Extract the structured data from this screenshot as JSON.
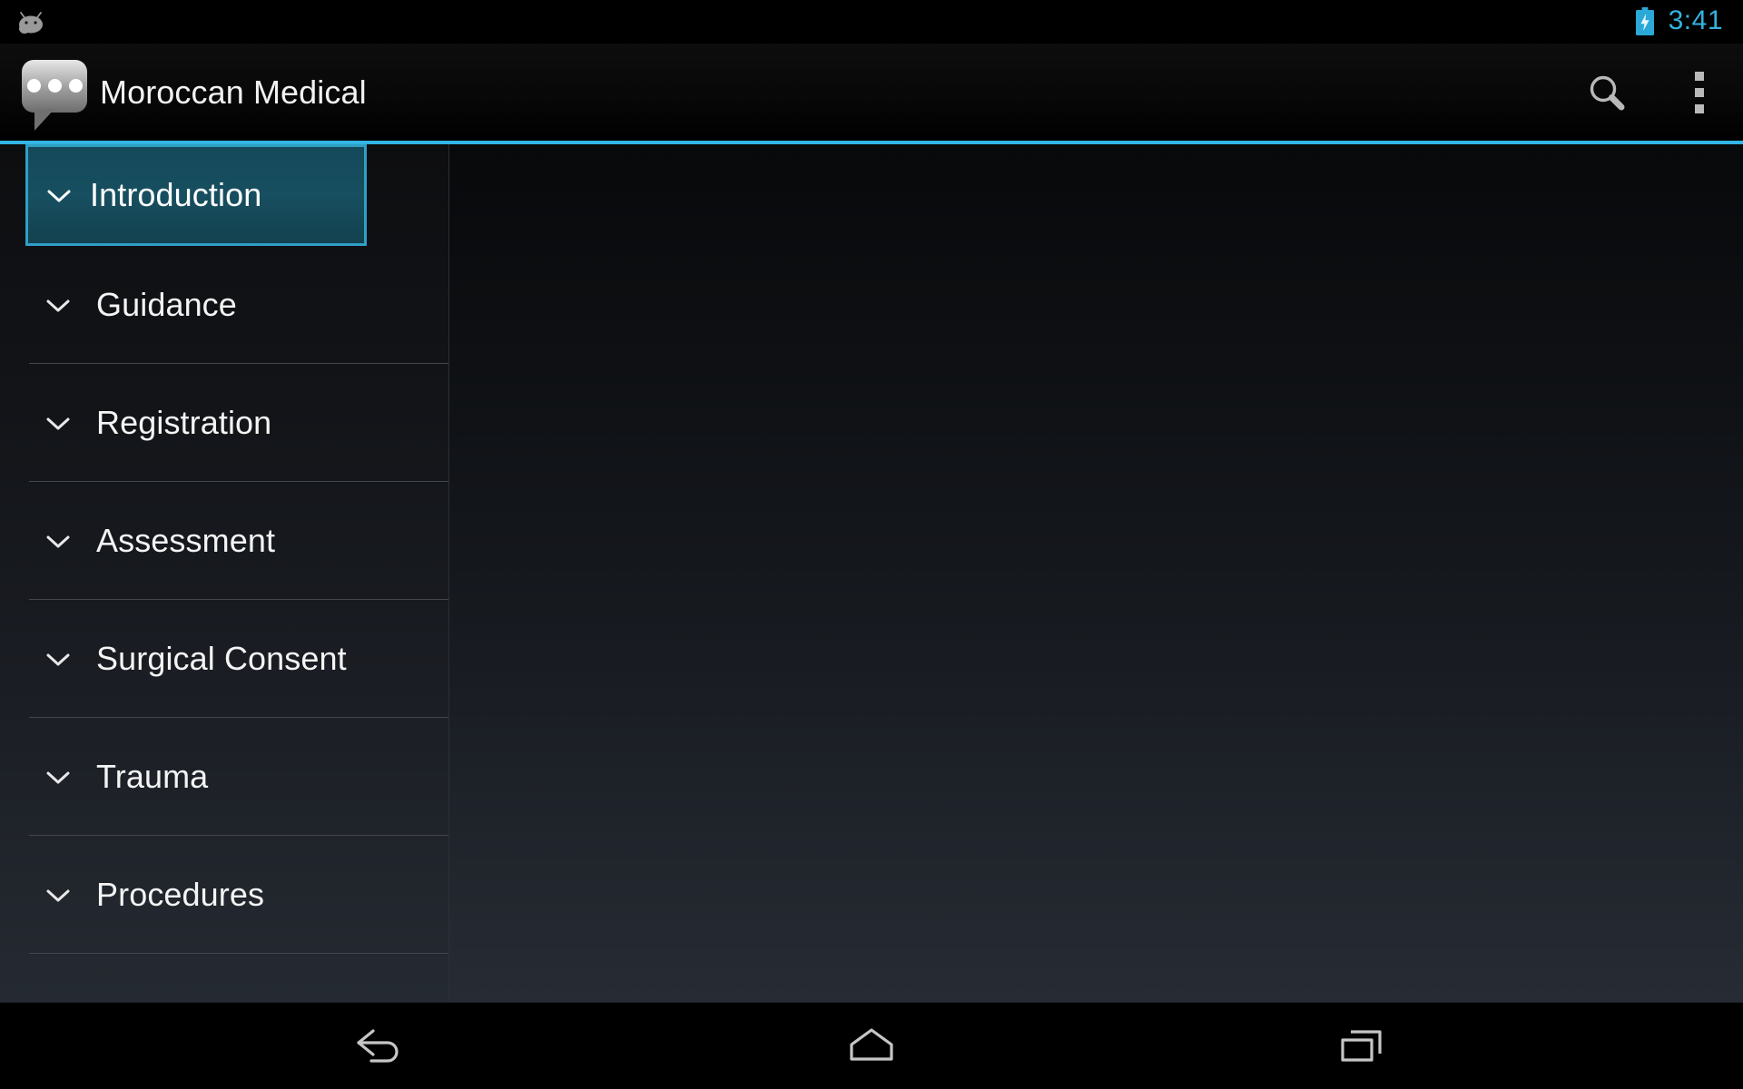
{
  "status_bar": {
    "notification_icon": "android-bean-icon",
    "battery_icon": "battery-charging-icon",
    "clock": "3:41",
    "clock_color": "#34b3e0"
  },
  "action_bar": {
    "app_icon": "speech-bubble-icon",
    "title": "Moroccan Medical",
    "search_icon": "search-icon",
    "overflow_icon": "overflow-menu-icon",
    "accent_color": "#33b5e5"
  },
  "sidebar": {
    "selected_index": 0,
    "selected_bg": "#174f60",
    "selected_border": "#2f9fc6",
    "expand_icon": "chevron-down-icon",
    "items": [
      {
        "label": "Introduction",
        "selected": true,
        "expanded": false
      },
      {
        "label": "Guidance",
        "selected": false,
        "expanded": false
      },
      {
        "label": "Registration",
        "selected": false,
        "expanded": false
      },
      {
        "label": "Assessment",
        "selected": false,
        "expanded": false
      },
      {
        "label": "Surgical Consent",
        "selected": false,
        "expanded": false
      },
      {
        "label": "Trauma",
        "selected": false,
        "expanded": false
      },
      {
        "label": "Procedures",
        "selected": false,
        "expanded": false
      },
      {
        "label": "",
        "selected": false,
        "expanded": false
      }
    ]
  },
  "content": {
    "body_text": ""
  },
  "nav_bar": {
    "back_icon": "back-arrow-icon",
    "home_icon": "home-icon",
    "recents_icon": "recent-apps-icon"
  }
}
